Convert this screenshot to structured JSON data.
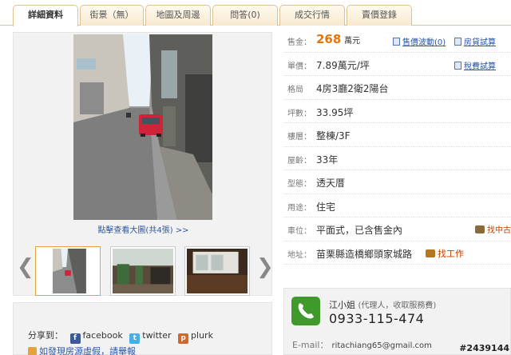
{
  "tabs": [
    {
      "label": "詳細資料",
      "active": true
    },
    {
      "label": "街景（無）",
      "active": false
    },
    {
      "label": "地圖及周邊",
      "active": false
    },
    {
      "label": "問答(0)",
      "active": false
    },
    {
      "label": "成交行情",
      "active": false
    },
    {
      "label": "賣價登錄",
      "active": false
    }
  ],
  "gallery": {
    "view_large_link": "點擊查看大圖(共4張) >>",
    "prev_arrow": "❮",
    "next_arrow": "❯"
  },
  "share": {
    "label": "分享到：",
    "facebook": "facebook",
    "twitter": "twitter",
    "plurk": "plurk",
    "help_link": "如發現房源虛假，請舉報"
  },
  "details": {
    "price_label": "售金：",
    "price_value": "268",
    "price_unit": "萬元",
    "price_history_link": "售價波動(0)",
    "loan_calc_link": "房貸試算",
    "unit_price_label": "單價：",
    "unit_price_value": "7.89萬元/坪",
    "tax_calc_link": "稅費試算",
    "layout_label": "格局",
    "layout_value": "4房3廳2衛2陽台",
    "area_label": "坪數：",
    "area_value": "33.95坪",
    "floor_label": "樓層：",
    "floor_value": "整棟/3F",
    "age_label": "屋齡：",
    "age_value": "33年",
    "type_label": "型態：",
    "type_value": "透天厝",
    "usage_label": "用途：",
    "usage_value": "住宅",
    "parking_label": "車位：",
    "parking_value": "平面式，已含售金內",
    "used_car_link": "找中古",
    "address_label": "地址：",
    "address_value": "苗栗縣造橋鄉頭家城路",
    "job_link": "找工作"
  },
  "contact": {
    "name": "江小姐",
    "role": "(代理人，收取服務費)",
    "phone": "0933-115-474",
    "email_label": "E-mail：",
    "email_value": "ritachiang65@gmail.com"
  },
  "watermark": "#2439144",
  "colors": {
    "price": "#e8750a",
    "link": "#2a56a8",
    "phone_icon": "#3e9a2a"
  }
}
